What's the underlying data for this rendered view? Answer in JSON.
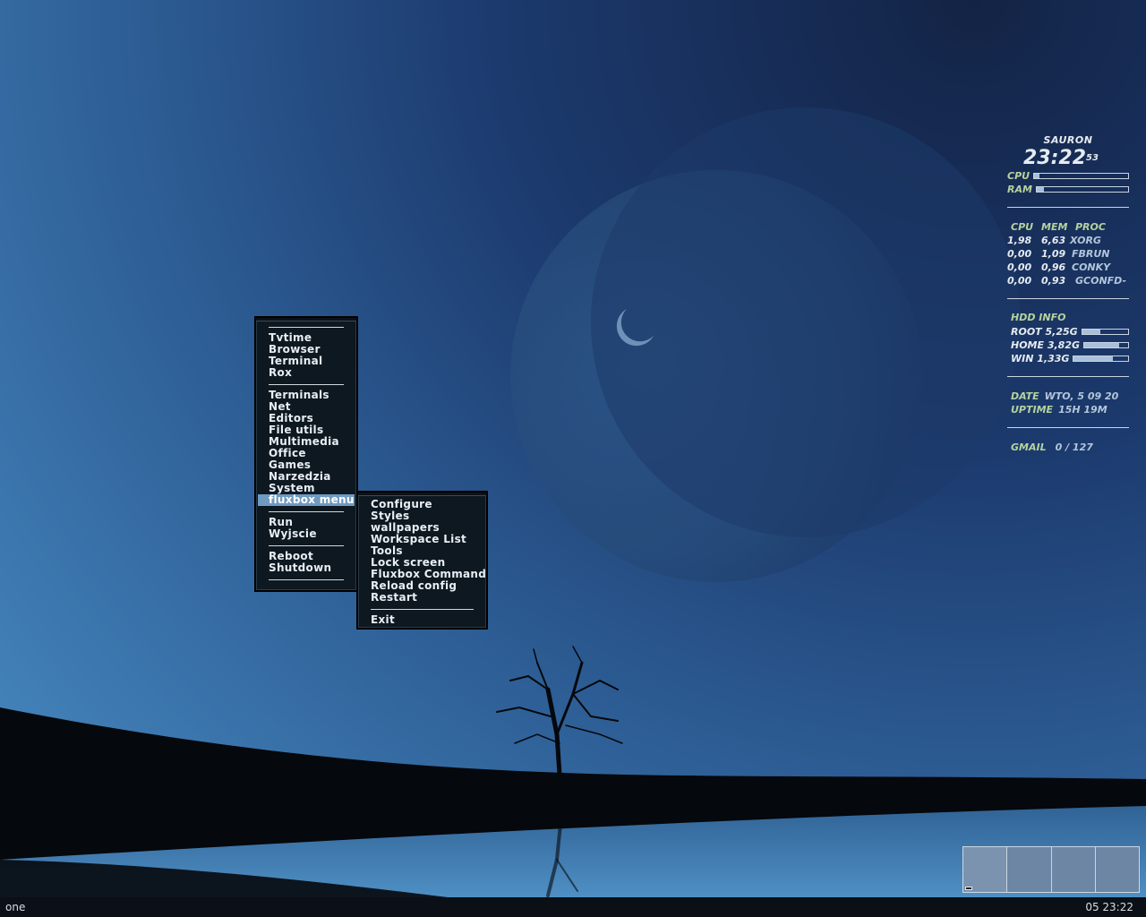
{
  "main_menu": {
    "groups": [
      [
        "Tvtime",
        "Browser",
        "Terminal",
        "Rox"
      ],
      [
        "Terminals",
        "Net",
        "Editors",
        "File utils",
        "Multimedia",
        "Office",
        "Games",
        "Narzedzia",
        "System",
        "fluxbox menu"
      ],
      [
        "Run",
        "Wyjscie"
      ],
      [
        "Reboot",
        "Shutdown"
      ]
    ],
    "active_item": "fluxbox menu"
  },
  "submenu": {
    "items": [
      "Configure",
      "Styles",
      "wallpapers",
      "Workspace List",
      "Tools",
      "Lock screen",
      "Fluxbox Command",
      "Reload config",
      "Restart"
    ],
    "last_item": "Exit"
  },
  "conky": {
    "hostname": "SAURON",
    "time": "23:22",
    "seconds": "53",
    "cpu_label": "CPU",
    "ram_label": "RAM",
    "cpu_usage": 0.06,
    "ram_usage": 0.08,
    "proc_headers": [
      "CPU",
      "MEM",
      "PROC"
    ],
    "processes": [
      {
        "cpu": "1,98",
        "mem": "6,63",
        "name": "XORG"
      },
      {
        "cpu": "0,00",
        "mem": "1,09",
        "name": "FBRUN"
      },
      {
        "cpu": "0,00",
        "mem": "0,96",
        "name": "CONKY"
      },
      {
        "cpu": "0,00",
        "mem": "0,93",
        "name": "GCONFD-"
      }
    ],
    "hdd_title": "HDD INFO",
    "disks": [
      {
        "label": "ROOT 5,25G",
        "usage": 0.4
      },
      {
        "label": "HOME 3,82G",
        "usage": 0.8
      },
      {
        "label": "WIN 1,33G",
        "usage": 0.72
      }
    ],
    "date_label": "DATE",
    "date_value": "WTO, 5 09 20",
    "uptime_label": "UPTIME",
    "uptime_value": "15H 19M",
    "gmail_label": "GMAIL",
    "gmail_value": "0  /  127"
  },
  "taskbar": {
    "workspace_name": "one",
    "clock": "05 23:22"
  },
  "pager": {
    "workspaces": 4,
    "active": 1
  }
}
